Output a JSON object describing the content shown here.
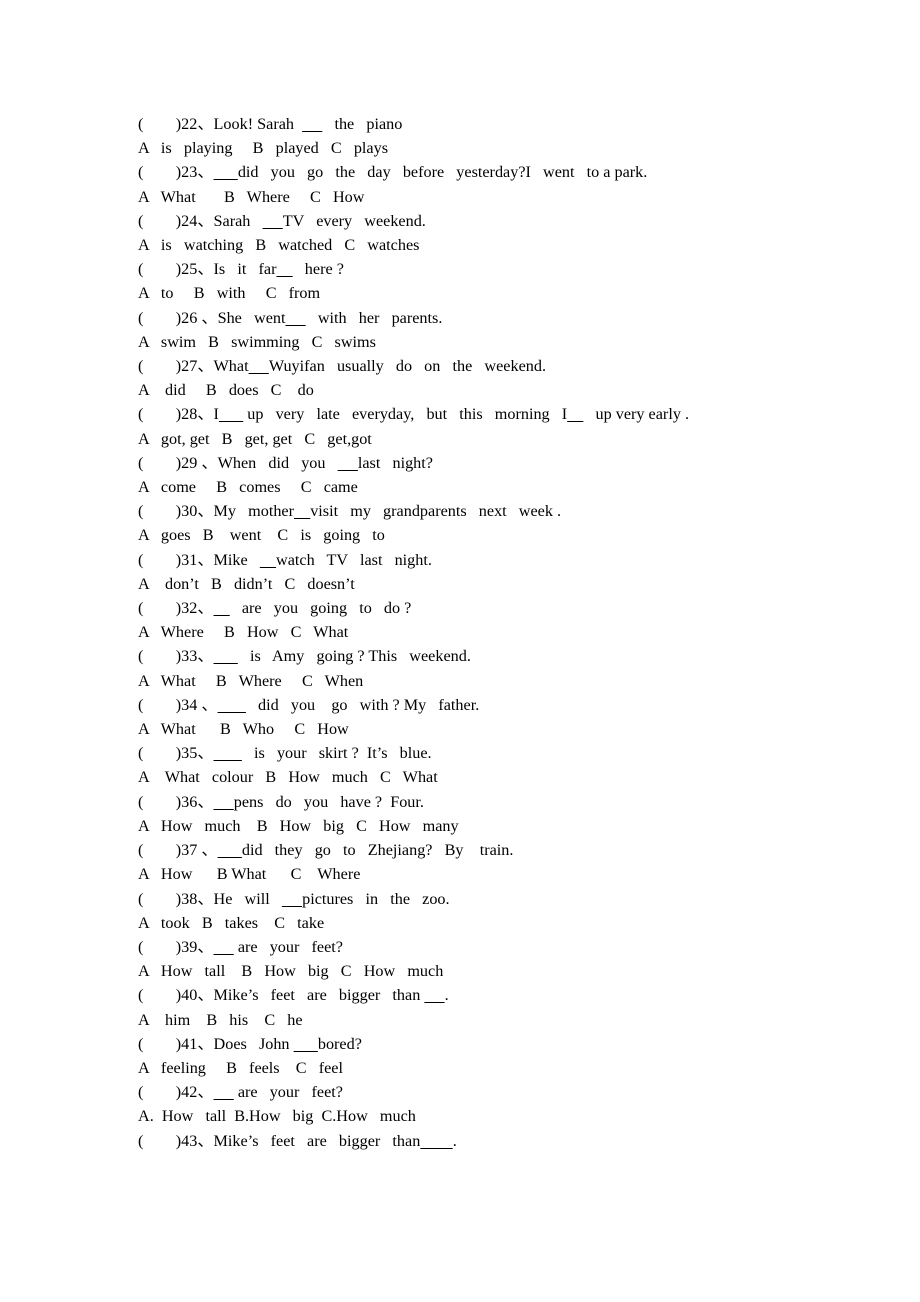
{
  "document": {
    "type": "worksheet",
    "background_color": "#ffffff",
    "text_color": "#000000",
    "item_count": 22,
    "first_item": "22",
    "last_item": "43"
  },
  "lines": [
    {
      "id": "q22",
      "kind": "question",
      "text": "(        )22、Look! Sarah  _____   the   piano"
    },
    {
      "id": "o22",
      "kind": "options",
      "text": "A   is   playing     B   played   C   plays"
    },
    {
      "id": "q23",
      "kind": "question",
      "text": "(        )23、______did   you   go   the   day   before   yesterday?I   went   to a park."
    },
    {
      "id": "o23",
      "kind": "options",
      "text": "A   What       B   Where     C   How"
    },
    {
      "id": "q24",
      "kind": "question",
      "text": "(        )24、Sarah   _____TV   every   weekend."
    },
    {
      "id": "o24",
      "kind": "options",
      "text": "A   is   watching   B   watched   C   watches"
    },
    {
      "id": "q25",
      "kind": "question",
      "text": "(        )25、Is   it   far____   here ?"
    },
    {
      "id": "o25",
      "kind": "options",
      "text": "A   to     B   with     C   from"
    },
    {
      "id": "q26",
      "kind": "question",
      "text": "(        )26 、She   went_____   with   her   parents."
    },
    {
      "id": "o26",
      "kind": "options",
      "text": "A   swim   B   swimming   C   swims"
    },
    {
      "id": "q27",
      "kind": "question",
      "text": "(        )27、What_____Wuyifan   usually   do   on   the   weekend."
    },
    {
      "id": "o27",
      "kind": "options",
      "text": "A    did     B   does   C    do"
    },
    {
      "id": "q28",
      "kind": "question",
      "text": "(        )28、I______ up   very   late   everyday,   but   this   morning   I____   up very early ."
    },
    {
      "id": "o28",
      "kind": "options",
      "text": "A   got, get   B   get, get   C   get,got"
    },
    {
      "id": "q29",
      "kind": "question",
      "text": "(        )29 、When   did   you   _____last   night?"
    },
    {
      "id": "o29",
      "kind": "options",
      "text": "A   come     B   comes     C   came"
    },
    {
      "id": "q30",
      "kind": "question",
      "text": "(        )30、My   mother____visit   my   grandparents   next   week ."
    },
    {
      "id": "o30",
      "kind": "options",
      "text": "A   goes   B    went    C   is   going   to"
    },
    {
      "id": "q31",
      "kind": "question",
      "text": "(        )31、Mike   ____watch   TV   last   night."
    },
    {
      "id": "o31",
      "kind": "options",
      "text": "A    don’t   B   didn’t   C   doesn’t"
    },
    {
      "id": "q32",
      "kind": "question",
      "text": "(        )32、____   are   you   going   to   do ?"
    },
    {
      "id": "o32",
      "kind": "options",
      "text": "A   Where     B   How   C   What"
    },
    {
      "id": "q33",
      "kind": "question",
      "text": "(        )33、______   is   Amy   going ? This   weekend."
    },
    {
      "id": "o33",
      "kind": "options",
      "text": "A   What     B   Where     C   When"
    },
    {
      "id": "q34",
      "kind": "question",
      "text": "(        )34 、_______   did   you    go   with ? My   father."
    },
    {
      "id": "o34",
      "kind": "options",
      "text": "A   What      B   Who     C   How"
    },
    {
      "id": "q35",
      "kind": "question",
      "text": "(        )35、_______   is   your   skirt ?  It’s   blue."
    },
    {
      "id": "o35",
      "kind": "options",
      "text": "A    What   colour   B   How   much   C   What"
    },
    {
      "id": "q36",
      "kind": "question",
      "text": "(        )36、_____pens   do   you   have ?  Four."
    },
    {
      "id": "o36",
      "kind": "options",
      "text": "A   How   much    B   How   big   C   How   many"
    },
    {
      "id": "q37",
      "kind": "question",
      "text": "(        )37 、______did   they   go   to   Zhejiang?   By    train."
    },
    {
      "id": "o37",
      "kind": "options",
      "text": "A   How      B What      C    Where"
    },
    {
      "id": "q38",
      "kind": "question",
      "text": "(        )38、He   will   _____pictures   in   the   zoo."
    },
    {
      "id": "o38",
      "kind": "options",
      "text": "A   took   B   takes    C   take"
    },
    {
      "id": "q39",
      "kind": "question",
      "text": "(        )39、_____ are   your   feet?"
    },
    {
      "id": "o39",
      "kind": "options",
      "text": "A   How   tall    B   How   big   C   How   much"
    },
    {
      "id": "q40",
      "kind": "question",
      "text": "(        )40、Mike’s   feet   are   bigger   than _____."
    },
    {
      "id": "o40",
      "kind": "options",
      "text": "A    him    B   his    C   he"
    },
    {
      "id": "q41",
      "kind": "question",
      "text": "(        )41、Does   John ______bored?"
    },
    {
      "id": "o41",
      "kind": "options",
      "text": "A   feeling     B   feels    C   feel"
    },
    {
      "id": "q42",
      "kind": "question",
      "text": "(        )42、_____ are   your   feet?"
    },
    {
      "id": "o42",
      "kind": "options",
      "text": "A.  How   tall  B.How   big  C.How   much"
    },
    {
      "id": "q43",
      "kind": "question",
      "text": "(        )43、Mike’s   feet   are   bigger   than________."
    }
  ]
}
